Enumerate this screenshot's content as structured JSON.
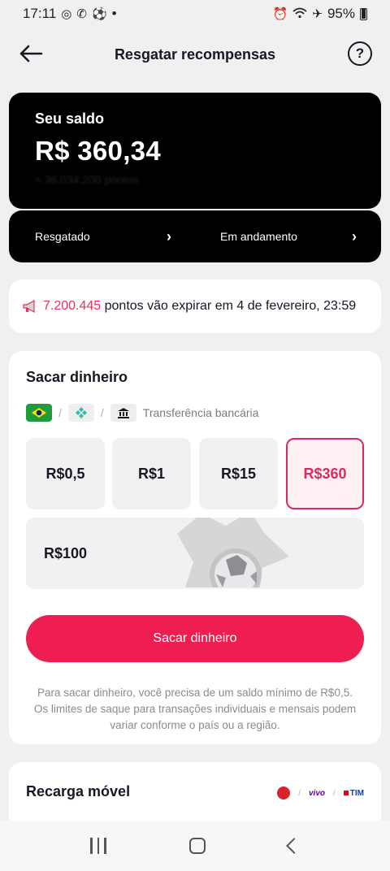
{
  "status_bar": {
    "time": "17:11",
    "battery": "95%",
    "dot": "•"
  },
  "header": {
    "title": "Resgatar recompensas",
    "help": "?"
  },
  "balance": {
    "label": "Seu saldo",
    "value": "R$ 360,34",
    "points": "≈ 36.034.200 pontos"
  },
  "links": [
    {
      "label": "Resgatado",
      "chevron": "›"
    },
    {
      "label": "Em andamento",
      "chevron": "›"
    }
  ],
  "expire": {
    "points": "7.200.445",
    "text": " pontos vão expirar em 4 de fevereiro, 23:59"
  },
  "withdraw": {
    "title": "Sacar dinheiro",
    "method_bank": "Transferência bancária",
    "slash": "/",
    "amounts": [
      "R$0,5",
      "R$1",
      "R$15",
      "R$360",
      "R$100"
    ],
    "selected_amount": "R$360",
    "button": "Sacar dinheiro",
    "disclaimer": "Para sacar dinheiro, você precisa de um saldo mínimo de R$0,5. Os limites de saque para transações individuais e mensais podem variar conforme o país ou a região."
  },
  "recharge": {
    "title": "Recarga móvel",
    "carriers": [
      "vivo",
      "TIM"
    ],
    "slash": "/"
  },
  "colors": {
    "accent": "#ee1d52",
    "selected": "#e0285a",
    "points": "#e7325a"
  }
}
